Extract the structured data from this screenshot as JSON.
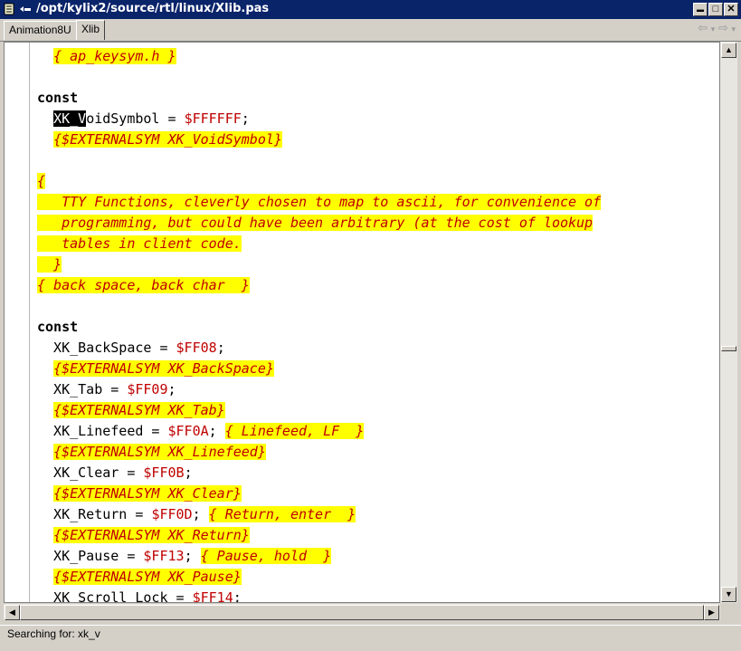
{
  "window": {
    "title": "/opt/kylix2/source/rtl/linux/Xlib.pas",
    "buttons": {
      "minimize": "▬",
      "maximize": "□",
      "close": "✕"
    }
  },
  "tabs": [
    {
      "label": "Animation8U"
    },
    {
      "label": "Xlib"
    }
  ],
  "nav": {
    "back": "⇦",
    "back_drop": "▾",
    "forward": "⇨",
    "forward_drop": "▾"
  },
  "editor": {
    "lines": [
      [
        {
          "t": "  "
        },
        {
          "t": "{ ap_keysym.h }",
          "c": "cm"
        }
      ],
      [
        {
          "t": ""
        }
      ],
      [
        {
          "t": "const",
          "c": "kw"
        }
      ],
      [
        {
          "t": "  "
        },
        {
          "t": "XK_V",
          "c": "sel"
        },
        {
          "t": "oidSymbol = "
        },
        {
          "t": "$FFFFFF",
          "c": "num"
        },
        {
          "t": ";"
        }
      ],
      [
        {
          "t": "  "
        },
        {
          "t": "{$EXTERNALSYM XK_VoidSymbol}",
          "c": "cm"
        }
      ],
      [
        {
          "t": ""
        }
      ],
      [
        {
          "t": "{",
          "c": "cm"
        }
      ],
      [
        {
          "t": "   TTY Functions, cleverly chosen to map to ascii, for convenience of",
          "c": "cm"
        }
      ],
      [
        {
          "t": "   programming, but could have been arbitrary (at the cost of lookup",
          "c": "cm"
        }
      ],
      [
        {
          "t": "   tables in client code.",
          "c": "cm"
        }
      ],
      [
        {
          "t": "  }",
          "c": "cm"
        }
      ],
      [
        {
          "t": "{ back space, back char  }",
          "c": "cm"
        }
      ],
      [
        {
          "t": ""
        }
      ],
      [
        {
          "t": "const",
          "c": "kw"
        }
      ],
      [
        {
          "t": "  XK_BackSpace = "
        },
        {
          "t": "$FF08",
          "c": "num"
        },
        {
          "t": ";"
        }
      ],
      [
        {
          "t": "  "
        },
        {
          "t": "{$EXTERNALSYM XK_BackSpace}",
          "c": "cm"
        }
      ],
      [
        {
          "t": "  XK_Tab = "
        },
        {
          "t": "$FF09",
          "c": "num"
        },
        {
          "t": ";"
        }
      ],
      [
        {
          "t": "  "
        },
        {
          "t": "{$EXTERNALSYM XK_Tab}",
          "c": "cm"
        }
      ],
      [
        {
          "t": "  XK_Linefeed = "
        },
        {
          "t": "$FF0A",
          "c": "num"
        },
        {
          "t": "; "
        },
        {
          "t": "{ Linefeed, LF  }",
          "c": "cm"
        }
      ],
      [
        {
          "t": "  "
        },
        {
          "t": "{$EXTERNALSYM XK_Linefeed}",
          "c": "cm"
        }
      ],
      [
        {
          "t": "  XK_Clear = "
        },
        {
          "t": "$FF0B",
          "c": "num"
        },
        {
          "t": ";"
        }
      ],
      [
        {
          "t": "  "
        },
        {
          "t": "{$EXTERNALSYM XK_Clear}",
          "c": "cm"
        }
      ],
      [
        {
          "t": "  XK_Return = "
        },
        {
          "t": "$FF0D",
          "c": "num"
        },
        {
          "t": "; "
        },
        {
          "t": "{ Return, enter  }",
          "c": "cm"
        }
      ],
      [
        {
          "t": "  "
        },
        {
          "t": "{$EXTERNALSYM XK_Return}",
          "c": "cm"
        }
      ],
      [
        {
          "t": "  XK_Pause = "
        },
        {
          "t": "$FF13",
          "c": "num"
        },
        {
          "t": "; "
        },
        {
          "t": "{ Pause, hold  }",
          "c": "cm"
        }
      ],
      [
        {
          "t": "  "
        },
        {
          "t": "{$EXTERNALSYM XK_Pause}",
          "c": "cm"
        }
      ],
      [
        {
          "t": "  XK_Scroll_Lock = "
        },
        {
          "t": "$FF14",
          "c": "num"
        },
        {
          "t": ";"
        }
      ]
    ]
  },
  "scrollbars": {
    "up": "▲",
    "down": "▼",
    "left": "◀",
    "right": "▶",
    "vertical_position": 0.55,
    "horizontal_position": 0.0
  },
  "status": {
    "text": "Searching for: xk_v"
  }
}
